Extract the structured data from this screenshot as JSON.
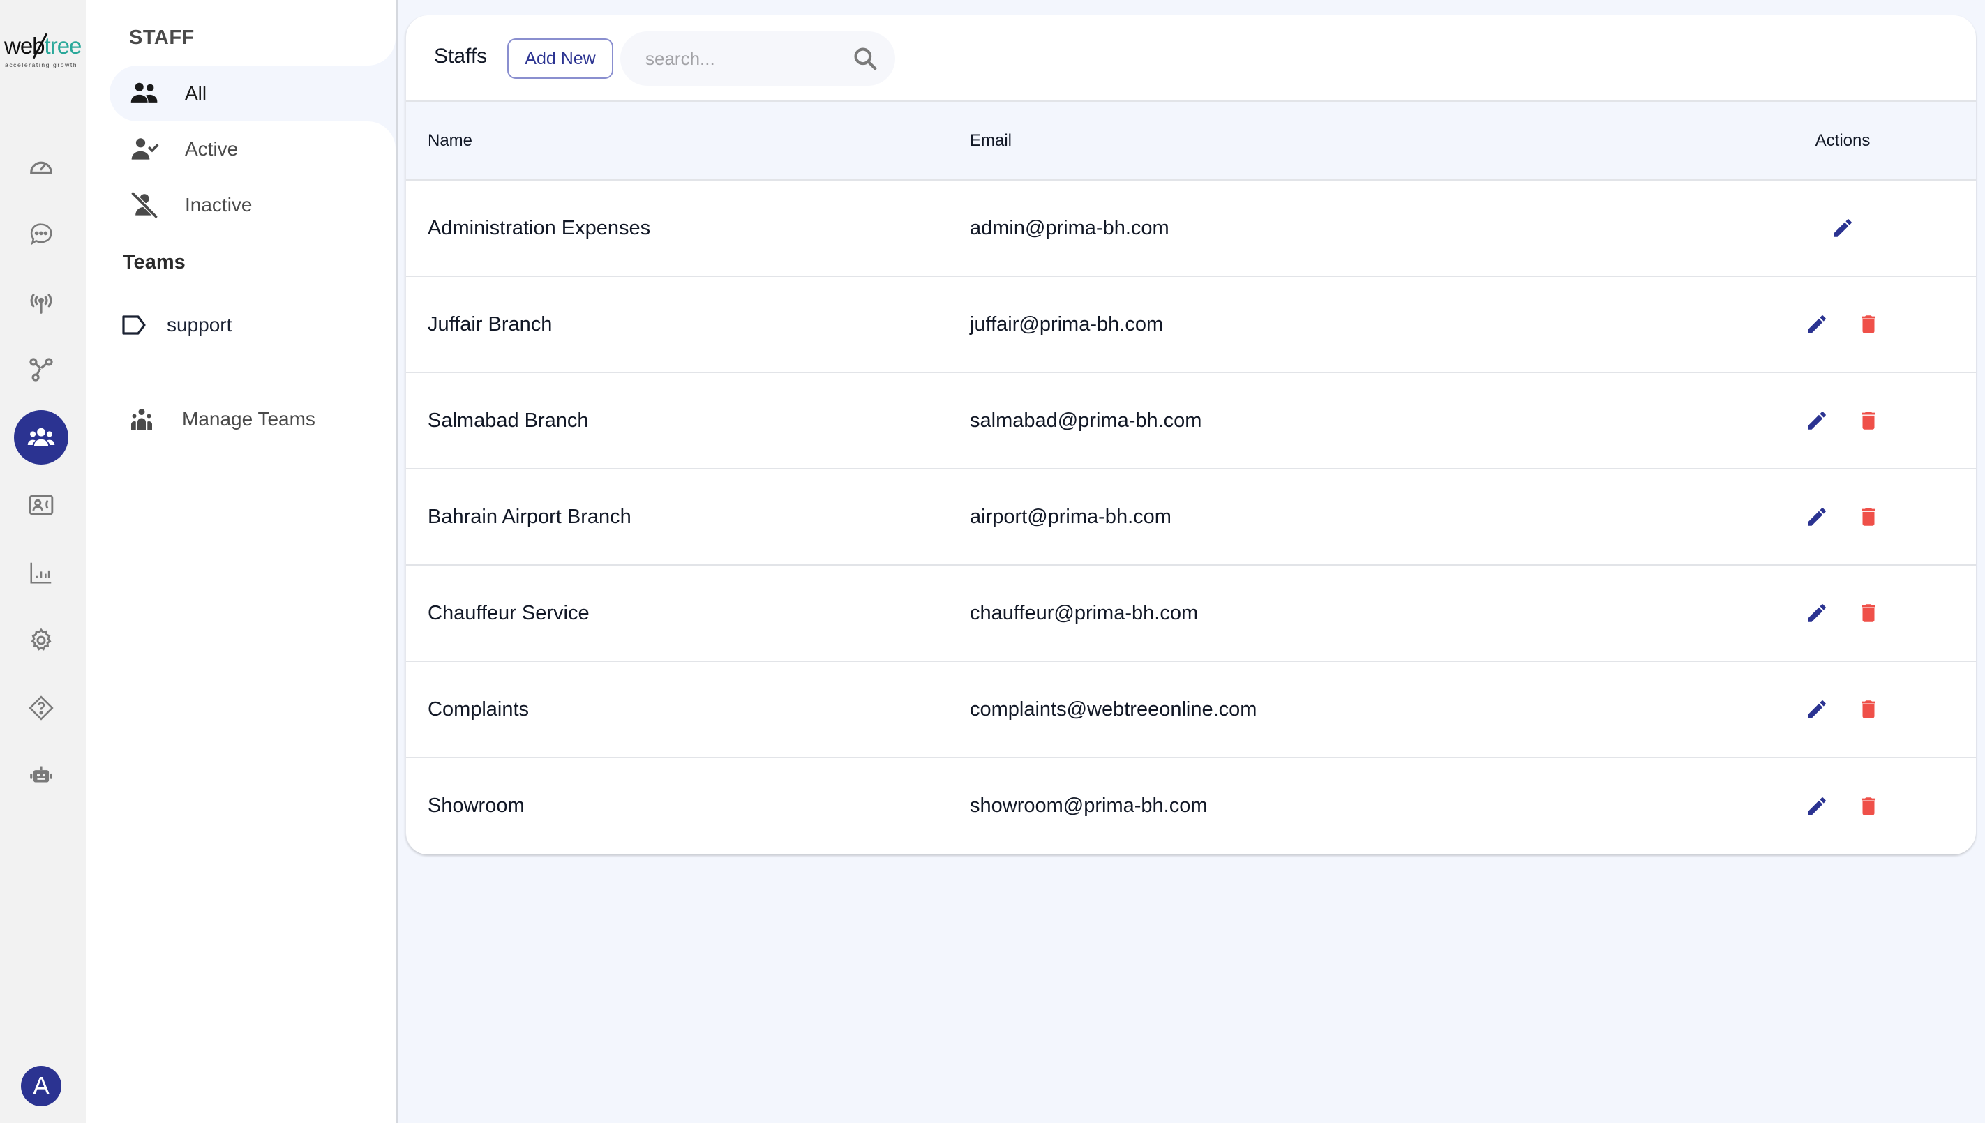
{
  "brand": {
    "logo_word_a": "web",
    "logo_word_b": "tree",
    "logo_tagline": "accelerating growth"
  },
  "rail": {
    "items": [
      {
        "name": "dashboard",
        "icon": "speedometer-icon",
        "active": false
      },
      {
        "name": "chat",
        "icon": "chat-bubble-icon",
        "active": false
      },
      {
        "name": "broadcast",
        "icon": "antenna-icon",
        "active": false
      },
      {
        "name": "flows",
        "icon": "nodes-icon",
        "active": false
      },
      {
        "name": "staff",
        "icon": "users-icon",
        "active": true
      },
      {
        "name": "contacts",
        "icon": "contact-card-icon",
        "active": false
      },
      {
        "name": "reports",
        "icon": "bar-chart-icon",
        "active": false
      },
      {
        "name": "settings",
        "icon": "gear-icon",
        "active": false
      },
      {
        "name": "help",
        "icon": "help-diamond-icon",
        "active": false
      },
      {
        "name": "bot",
        "icon": "robot-icon",
        "active": false
      }
    ],
    "avatar_initial": "A",
    "accent": "#2b3391"
  },
  "sidebar": {
    "section_title": "STAFF",
    "items": [
      {
        "label": "All",
        "icon": "users-icon",
        "selected": true
      },
      {
        "label": "Active",
        "icon": "user-check-icon",
        "selected": false
      },
      {
        "label": "Inactive",
        "icon": "user-slash-icon",
        "selected": false
      }
    ],
    "teams_title": "Teams",
    "teams": [
      {
        "label": "support",
        "icon": "tag-icon"
      }
    ],
    "manage_teams_label": "Manage Teams"
  },
  "main": {
    "title": "Staffs",
    "add_new_label": "Add New",
    "search_placeholder": "search...",
    "search_value": "",
    "table": {
      "columns": [
        "Name",
        "Email",
        "Actions"
      ],
      "rows": [
        {
          "name": "Administration Expenses",
          "email": "admin@prima-bh.com",
          "can_delete": false
        },
        {
          "name": "Juffair Branch",
          "email": "juffair@prima-bh.com",
          "can_delete": true
        },
        {
          "name": "Salmabad Branch",
          "email": "salmabad@prima-bh.com",
          "can_delete": true
        },
        {
          "name": "Bahrain Airport Branch",
          "email": "airport@prima-bh.com",
          "can_delete": true
        },
        {
          "name": "Chauffeur Service",
          "email": "chauffeur@prima-bh.com",
          "can_delete": true
        },
        {
          "name": "Complaints",
          "email": "complaints@webtreeonline.com",
          "can_delete": true
        },
        {
          "name": "Showroom",
          "email": "showroom@prima-bh.com",
          "can_delete": true
        }
      ]
    },
    "colors": {
      "edit": "#2b3391",
      "delete": "#ef5049",
      "background": "#f3f6fd"
    }
  }
}
